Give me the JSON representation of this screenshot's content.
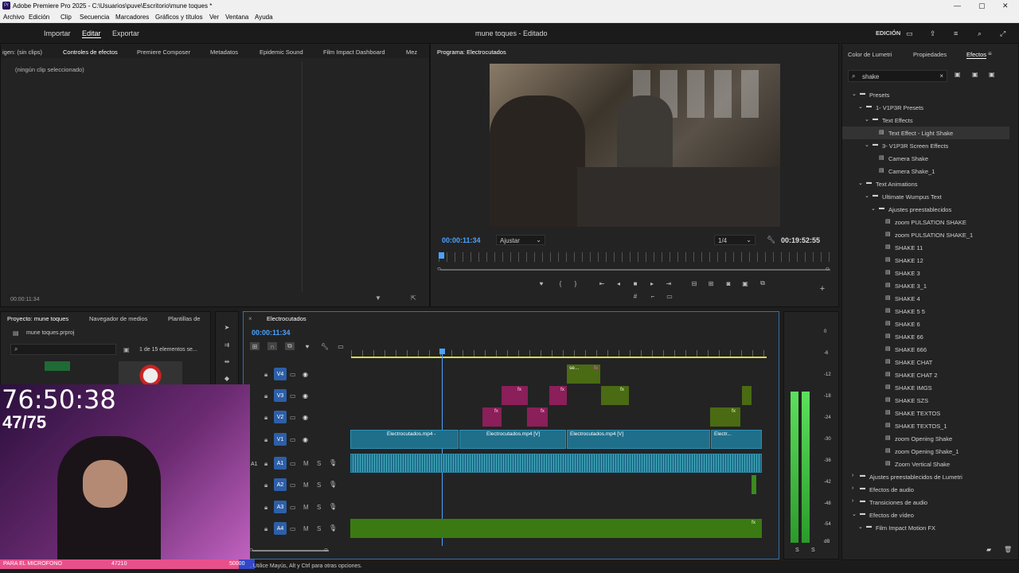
{
  "window": {
    "title": "Adobe Premiere Pro 2025 - C:\\Usuarios\\puve\\Escritorio\\mune toques *"
  },
  "menu": [
    "Archivo",
    "Edición",
    "Clip",
    "Secuencia",
    "Marcadores",
    "Gráficos y títulos",
    "Ver",
    "Ventana",
    "Ayuda"
  ],
  "workspace": {
    "tabs": [
      "Importar",
      "Editar",
      "Exportar"
    ],
    "center_title": "mune toques - Editado",
    "mode": "EDICIÓN"
  },
  "effects_panel": {
    "tabs": [
      "igen: (sin clips)",
      "Controles de efectos",
      "Premiere Composer",
      "Metadatos",
      "Epidemic Sound",
      "Film Impact Dashboard",
      "Mez"
    ],
    "empty_text": "(ningún clip seleccionado)",
    "timecode": "00:00:11:34"
  },
  "program": {
    "tab": "Programa: Electrocutados",
    "timecode": "00:00:11:34",
    "fit": "Ajustar",
    "res": "1/4",
    "duration": "00:19:52:55"
  },
  "project": {
    "tabs": [
      "Proyecto: mune toques",
      "Navegador de medios",
      "Plantillas de"
    ],
    "file": "mune toques.prproj",
    "count": "1 de 15 elementos se..."
  },
  "timeline": {
    "tab": "Electrocutados",
    "timecode": "00:00:11:34",
    "tracks_v": [
      "V4",
      "V3",
      "V2",
      "V1"
    ],
    "tracks_a": [
      "A1",
      "A2",
      "A3",
      "A4"
    ],
    "a1_label": "A1",
    "clip_labels": [
      "Electrocutados.mp4 -",
      "Electrocutados.mp4 [V]",
      "Electrocutados.mp4 [V]",
      "Electr...",
      "se..."
    ],
    "fx": "fx"
  },
  "meter": {
    "scale": [
      "0",
      "-6",
      "-12",
      "-18",
      "-24",
      "-30",
      "-36",
      "-42",
      "-48",
      "-54",
      "dB"
    ],
    "channels": [
      "S",
      "S"
    ]
  },
  "right_panel": {
    "tabs": [
      "Color de Lumetri",
      "Propiedades",
      "Efectos"
    ],
    "search": "shake",
    "tree": [
      {
        "label": "Presets",
        "indent": 0,
        "type": "folder",
        "open": true
      },
      {
        "label": "1- V1P3R Presets",
        "indent": 1,
        "type": "folder",
        "open": true
      },
      {
        "label": "Text Effects",
        "indent": 2,
        "type": "folder",
        "open": true
      },
      {
        "label": "Text Effect - Light Shake",
        "indent": 3,
        "type": "item",
        "selected": true
      },
      {
        "label": "3- V1P3R Screen Effects",
        "indent": 2,
        "type": "folder",
        "open": true
      },
      {
        "label": "Camera Shake",
        "indent": 3,
        "type": "item"
      },
      {
        "label": "Camera Shake_1",
        "indent": 3,
        "type": "item"
      },
      {
        "label": "Text Animations",
        "indent": 1,
        "type": "folder",
        "open": true
      },
      {
        "label": "Ultimate Wumpus Text",
        "indent": 2,
        "type": "folder",
        "open": true
      },
      {
        "label": "Ajustes preestablecidos",
        "indent": 3,
        "type": "folder",
        "open": true
      },
      {
        "label": "zoom PULSATION SHAKE",
        "indent": 4,
        "type": "item"
      },
      {
        "label": "zoom PULSATION SHAKE_1",
        "indent": 4,
        "type": "item"
      },
      {
        "label": "SHAKE 11",
        "indent": 4,
        "type": "item"
      },
      {
        "label": "SHAKE 12",
        "indent": 4,
        "type": "item"
      },
      {
        "label": "SHAKE 3",
        "indent": 4,
        "type": "item"
      },
      {
        "label": "SHAKE 3_1",
        "indent": 4,
        "type": "item"
      },
      {
        "label": "SHAKE 4",
        "indent": 4,
        "type": "item"
      },
      {
        "label": "SHAKE 5 5",
        "indent": 4,
        "type": "item"
      },
      {
        "label": "SHAKE 6",
        "indent": 4,
        "type": "item"
      },
      {
        "label": "SHAKE 66",
        "indent": 4,
        "type": "item"
      },
      {
        "label": "SHAKE 666",
        "indent": 4,
        "type": "item"
      },
      {
        "label": "SHAKE CHAT",
        "indent": 4,
        "type": "item"
      },
      {
        "label": "SHAKE CHAT 2",
        "indent": 4,
        "type": "item"
      },
      {
        "label": "SHAKE IMGS",
        "indent": 4,
        "type": "item"
      },
      {
        "label": "SHAKE SZS",
        "indent": 4,
        "type": "item"
      },
      {
        "label": "SHAKE TEXTOS",
        "indent": 4,
        "type": "item"
      },
      {
        "label": "SHAKE TEXTOS_1",
        "indent": 4,
        "type": "item"
      },
      {
        "label": "zoom Opening Shake",
        "indent": 4,
        "type": "item"
      },
      {
        "label": "zoom Opening Shake_1",
        "indent": 4,
        "type": "item"
      },
      {
        "label": "Zoom Vertical Shake",
        "indent": 4,
        "type": "item"
      },
      {
        "label": "Ajustes preestablecidos de Lumetri",
        "indent": 0,
        "type": "folder",
        "open": false
      },
      {
        "label": "Efectos de audio",
        "indent": 0,
        "type": "folder",
        "open": false
      },
      {
        "label": "Transiciones de audio",
        "indent": 0,
        "type": "folder",
        "open": false
      },
      {
        "label": "Efectos de vídeo",
        "indent": 0,
        "type": "folder",
        "open": true
      },
      {
        "label": "Film Impact Motion FX",
        "indent": 1,
        "type": "folder",
        "open": true
      }
    ]
  },
  "overlay": {
    "timer": "76:50:38",
    "count": "47/75",
    "bar_left": "PARA EL MICROFONO",
    "bar_value": "47210",
    "bar_goal": "50000",
    "bar_fill": 0.94
  },
  "status": {
    "text": ". Utilice Mayús, Alt y Ctrl para otras opciones."
  }
}
